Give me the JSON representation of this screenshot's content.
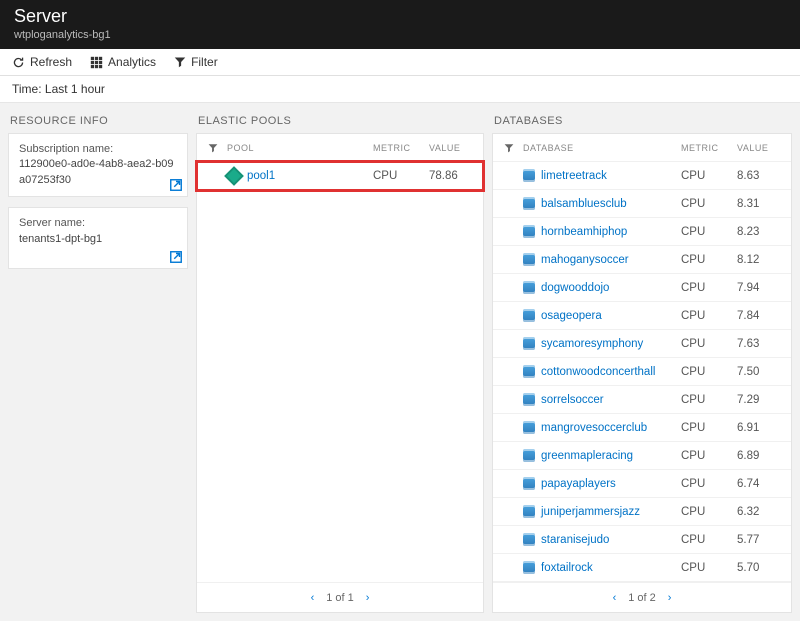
{
  "header": {
    "title": "Server",
    "subtitle": "wtploganalytics-bg1"
  },
  "toolbar": {
    "refresh": "Refresh",
    "analytics": "Analytics",
    "filter": "Filter"
  },
  "timebar": {
    "label": "Time: Last 1 hour"
  },
  "sections": {
    "resource_info": "RESOURCE INFO",
    "elastic_pools": "ELASTIC POOLS",
    "databases": "DATABASES"
  },
  "resource_info": {
    "subscription_label": "Subscription name:",
    "subscription_value": "112900e0-ad0e-4ab8-aea2-b09a07253f30",
    "server_label": "Server name:",
    "server_value": "tenants1-dpt-bg1"
  },
  "columns": {
    "pool": "POOL",
    "database": "DATABASE",
    "metric": "METRIC",
    "value": "VALUE"
  },
  "pools": {
    "rows": [
      {
        "name": "pool1",
        "metric": "CPU",
        "value": "78.86"
      }
    ],
    "pager": "1 of 1"
  },
  "databases": {
    "rows": [
      {
        "name": "limetreetrack",
        "metric": "CPU",
        "value": "8.63"
      },
      {
        "name": "balsambluesclub",
        "metric": "CPU",
        "value": "8.31"
      },
      {
        "name": "hornbeamhiphop",
        "metric": "CPU",
        "value": "8.23"
      },
      {
        "name": "mahoganysoccer",
        "metric": "CPU",
        "value": "8.12"
      },
      {
        "name": "dogwooddojo",
        "metric": "CPU",
        "value": "7.94"
      },
      {
        "name": "osageopera",
        "metric": "CPU",
        "value": "7.84"
      },
      {
        "name": "sycamoresymphony",
        "metric": "CPU",
        "value": "7.63"
      },
      {
        "name": "cottonwoodconcerthall",
        "metric": "CPU",
        "value": "7.50"
      },
      {
        "name": "sorrelsoccer",
        "metric": "CPU",
        "value": "7.29"
      },
      {
        "name": "mangrovesoccerclub",
        "metric": "CPU",
        "value": "6.91"
      },
      {
        "name": "greenmapleracing",
        "metric": "CPU",
        "value": "6.89"
      },
      {
        "name": "papayaplayers",
        "metric": "CPU",
        "value": "6.74"
      },
      {
        "name": "juniperjammersjazz",
        "metric": "CPU",
        "value": "6.32"
      },
      {
        "name": "staranisejudo",
        "metric": "CPU",
        "value": "5.77"
      },
      {
        "name": "foxtailrock",
        "metric": "CPU",
        "value": "5.70"
      }
    ],
    "pager": "1 of 2"
  }
}
